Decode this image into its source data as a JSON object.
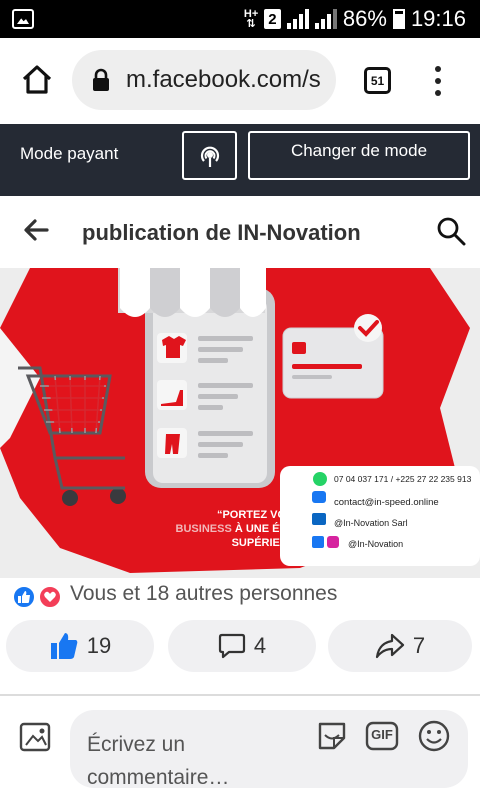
{
  "status_bar": {
    "network_top": "H+",
    "network_arrows": "⇅",
    "sim": "2",
    "battery": "86%",
    "time": "19:16"
  },
  "browser": {
    "url": "m.facebook.com/s",
    "tab_count": "51"
  },
  "mode_bar": {
    "label": "Mode payant",
    "change_button": "Changer de mode"
  },
  "page_header": {
    "title": "publication de IN-Novation"
  },
  "post": {
    "slogan_line1": "“PORTEZ VOTRE",
    "slogan_business": "BUSINESS",
    "slogan_line2": "À UNE ÉTAPE",
    "slogan_line3": "SUPÉRIEUR !”",
    "phone": "07 04 037 171 / +225 27 22 235 913",
    "email": "contact@in-speed.online",
    "linkedin": "@In-Novation Sarl",
    "social": "@In-Novation",
    "colors": {
      "brand_red": "#e0141c",
      "whatsapp_green": "#25d366",
      "facebook_blue": "#1877f2"
    }
  },
  "reactions": {
    "summary": "Vous et 18 autres personnes"
  },
  "actions": {
    "likes": "19",
    "comments": "4",
    "shares": "7"
  },
  "composer": {
    "placeholder": "Écrivez un commentaire…",
    "gif_label": "GIF"
  }
}
